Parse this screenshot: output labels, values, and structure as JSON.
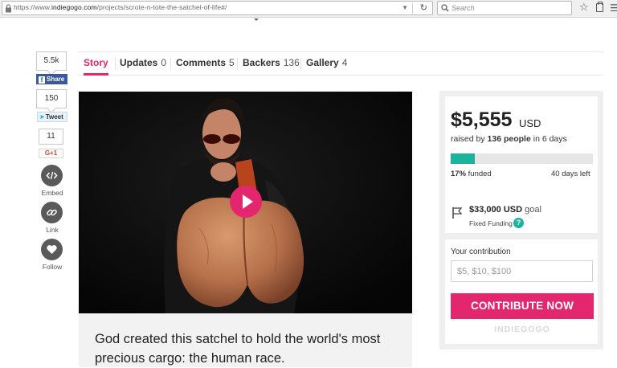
{
  "browser": {
    "url_prefix": "https://www.",
    "url_domain": "indiegogo.com",
    "url_path": "/projects/scrote-n-tote-the-satchel-of-life#/",
    "search_placeholder": "Search"
  },
  "social": {
    "facebook_count": "5.5k",
    "facebook_label": "Share",
    "twitter_count": "150",
    "twitter_label": "Tweet",
    "gplus_count": "11",
    "gplus_label": "G+1",
    "embed_label": "Embed",
    "link_label": "Link",
    "follow_label": "Follow"
  },
  "tabs": [
    {
      "label": "Story",
      "count": ""
    },
    {
      "label": "Updates",
      "count": "0"
    },
    {
      "label": "Comments",
      "count": "5"
    },
    {
      "label": "Backers",
      "count": "136"
    },
    {
      "label": "Gallery",
      "count": "4"
    }
  ],
  "pitch": "God created this satchel to hold the world's most precious cargo: the human race.",
  "campaign": {
    "amount": "$5,555",
    "currency": "USD",
    "raised_prefix": "raised by",
    "backers": "136 people",
    "raised_suffix": "in 6 days",
    "funded_percent": "17%",
    "funded_label": "funded",
    "funded_fraction": 0.17,
    "days_left": "40 days left",
    "goal_amount": "$33,000 USD",
    "goal_label": "goal",
    "funding_type": "Fixed Funding",
    "help_symbol": "?"
  },
  "contribution": {
    "label": "Your contribution",
    "placeholder": "$5, $10, $100",
    "button_label": "CONTRIBUTE NOW",
    "brand": "INDIEGOGO"
  },
  "colors": {
    "accent": "#e4266f",
    "progress": "#19b39e",
    "facebook": "#3b5998"
  }
}
